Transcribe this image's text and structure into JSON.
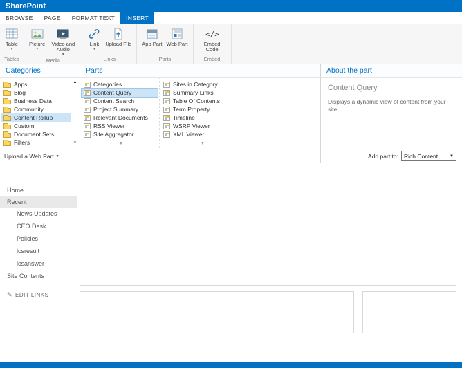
{
  "suite_bar": {
    "brand": "SharePoint"
  },
  "ribbon": {
    "tabs": [
      {
        "label": "BROWSE"
      },
      {
        "label": "PAGE"
      },
      {
        "label": "FORMAT TEXT"
      },
      {
        "label": "INSERT",
        "active": true
      }
    ],
    "groups": [
      {
        "label": "Tables",
        "buttons": [
          {
            "label": "Table",
            "icon": "table-icon",
            "dropdown": true
          }
        ]
      },
      {
        "label": "Media",
        "buttons": [
          {
            "label": "Picture",
            "icon": "picture-icon",
            "dropdown": true
          },
          {
            "label": "Video and Audio",
            "icon": "video-audio-icon",
            "dropdown": true
          }
        ]
      },
      {
        "label": "Links",
        "buttons": [
          {
            "label": "Link",
            "icon": "link-icon",
            "dropdown": true
          },
          {
            "label": "Upload File",
            "icon": "upload-file-icon",
            "dropdown": false
          }
        ]
      },
      {
        "label": "Parts",
        "buttons": [
          {
            "label": "App Part",
            "icon": "app-part-icon",
            "dropdown": false
          },
          {
            "label": "Web Part",
            "icon": "web-part-icon",
            "dropdown": false
          }
        ]
      },
      {
        "label": "Embed",
        "buttons": [
          {
            "label": "Embed Code",
            "icon": "embed-code-icon",
            "dropdown": false
          }
        ]
      }
    ]
  },
  "picker": {
    "categories": {
      "title": "Categories",
      "items": [
        {
          "label": "Apps"
        },
        {
          "label": "Blog"
        },
        {
          "label": "Business Data"
        },
        {
          "label": "Community"
        },
        {
          "label": "Content Rollup",
          "selected": true
        },
        {
          "label": "Custom"
        },
        {
          "label": "Document Sets"
        },
        {
          "label": "Filters"
        }
      ],
      "upload_label": "Upload a Web Part"
    },
    "parts": {
      "title": "Parts",
      "column1": [
        {
          "label": "Categories"
        },
        {
          "label": "Content Query",
          "selected": true
        },
        {
          "label": "Content Search"
        },
        {
          "label": "Project Summary"
        },
        {
          "label": "Relevant Documents"
        },
        {
          "label": "RSS Viewer"
        },
        {
          "label": "Site Aggregator"
        }
      ],
      "column2": [
        {
          "label": "Sites in Category"
        },
        {
          "label": "Summary Links"
        },
        {
          "label": "Table Of Contents"
        },
        {
          "label": "Term Property"
        },
        {
          "label": "Timeline"
        },
        {
          "label": "WSRP Viewer"
        },
        {
          "label": "XML Viewer"
        }
      ]
    },
    "about": {
      "title": "About the part",
      "part_name": "Content Query",
      "description": "Displays a dynamic view of content from your site.",
      "add_part_label": "Add part to:",
      "add_part_value": "Rich Content"
    }
  },
  "quick_launch": {
    "items": [
      {
        "label": "Home"
      },
      {
        "label": "Recent",
        "selected": true
      },
      {
        "label": "News Updates",
        "indent": true
      },
      {
        "label": "CEO Desk",
        "indent": true
      },
      {
        "label": "Policies",
        "indent": true
      },
      {
        "label": "lcsresult",
        "indent": true
      },
      {
        "label": "lcsanswer",
        "indent": true
      },
      {
        "label": "Site Contents"
      },
      {
        "label": "EDIT LINKS",
        "edit": true
      }
    ]
  },
  "colors": {
    "suite_bar": "#0072c6",
    "accent": "#0072c6",
    "selection": "#cbe4f8"
  }
}
